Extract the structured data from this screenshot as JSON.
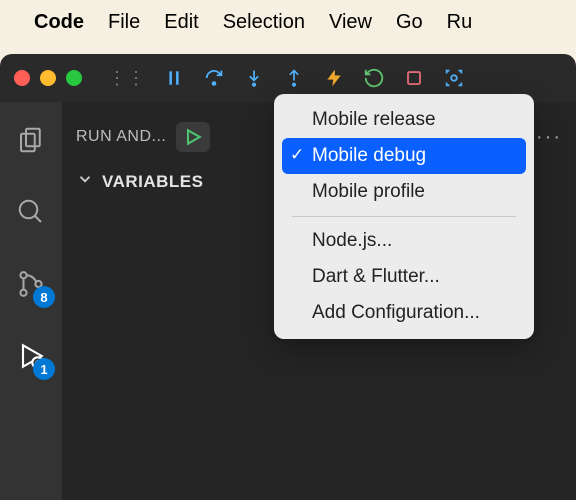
{
  "menubar": {
    "items": [
      "Code",
      "File",
      "Edit",
      "Selection",
      "View",
      "Go",
      "Ru"
    ]
  },
  "debug_toolbar": {
    "pause": "pause",
    "step_over": "step-over",
    "step_into": "step-into",
    "step_out": "step-out",
    "hot_reload": "hot-reload",
    "restart": "restart",
    "stop": "stop",
    "screenshot": "screenshot"
  },
  "activity": {
    "scm_badge": "8",
    "debug_badge": "1"
  },
  "panel": {
    "title": "RUN AND...",
    "more": "···",
    "section_variables": "VARIABLES"
  },
  "dropdown": {
    "items": [
      {
        "label": "Mobile release",
        "selected": false
      },
      {
        "label": "Mobile debug",
        "selected": true
      },
      {
        "label": "Mobile profile",
        "selected": false
      }
    ],
    "extra": [
      "Node.js...",
      "Dart & Flutter...",
      "Add Configuration..."
    ]
  }
}
